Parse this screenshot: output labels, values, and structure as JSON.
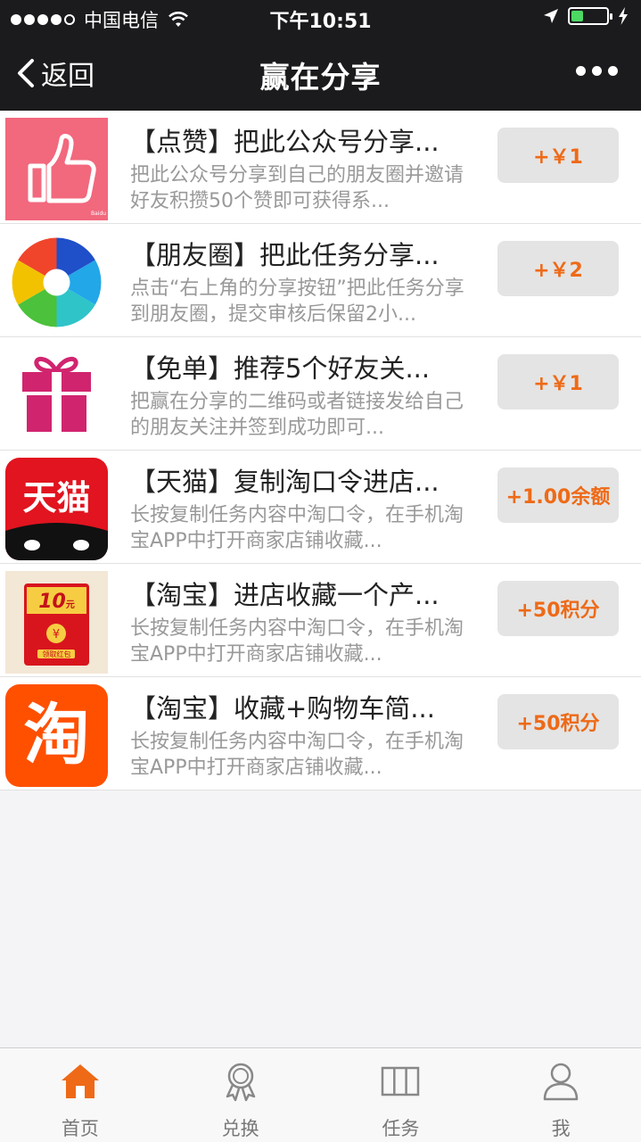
{
  "status_bar": {
    "carrier": "中国电信",
    "time": "下午10:51",
    "battery_level": 0.35
  },
  "nav": {
    "back_label": "返回",
    "title": "赢在分享"
  },
  "tasks": [
    {
      "title": "【点赞】把此公众号分享...",
      "desc": "把此公众号分享到自己的朋友圈并邀请好友积攒50个赞即可获得系...",
      "reward": "+￥1",
      "icon": "thumbs-up-icon"
    },
    {
      "title": "【朋友圈】把此任务分享...",
      "desc": "点击“右上角的分享按钮”把此任务分享到朋友圈，提交审核后保留2小...",
      "reward": "+￥2",
      "icon": "aperture-icon"
    },
    {
      "title": "【免单】推荐5个好友关...",
      "desc": "把赢在分享的二维码或者链接发给自己的朋友关注并签到成功即可...",
      "reward": "+￥1",
      "icon": "gift-icon"
    },
    {
      "title": "【天猫】复制淘口令进店...",
      "desc": "长按复制任务内容中淘口令，在手机淘宝APP中打开商家店铺收藏...",
      "reward": "+1.00余额",
      "icon": "tmall-icon",
      "icon_text": "天猫"
    },
    {
      "title": "【淘宝】进店收藏一个产...",
      "desc": "长按复制任务内容中淘口令，在手机淘宝APP中打开商家店铺收藏...",
      "reward": "+50积分",
      "icon": "red-envelope-icon",
      "icon_text": "10",
      "icon_text_unit": "元",
      "icon_caption": "领取红包"
    },
    {
      "title": "【淘宝】收藏+购物车简...",
      "desc": "长按复制任务内容中淘口令，在手机淘宝APP中打开商家店铺收藏...",
      "reward": "+50积分",
      "icon": "taobao-icon",
      "icon_text": "淘"
    }
  ],
  "tabbar": [
    {
      "label": "首页",
      "icon": "home-icon",
      "active": true
    },
    {
      "label": "兑换",
      "icon": "medal-icon"
    },
    {
      "label": "任务",
      "icon": "columns-icon"
    },
    {
      "label": "我",
      "icon": "user-icon"
    }
  ],
  "colors": {
    "accent": "#ee6a17",
    "bar_bg": "#1b1b1d",
    "reward_bg": "#e4e4e4"
  }
}
